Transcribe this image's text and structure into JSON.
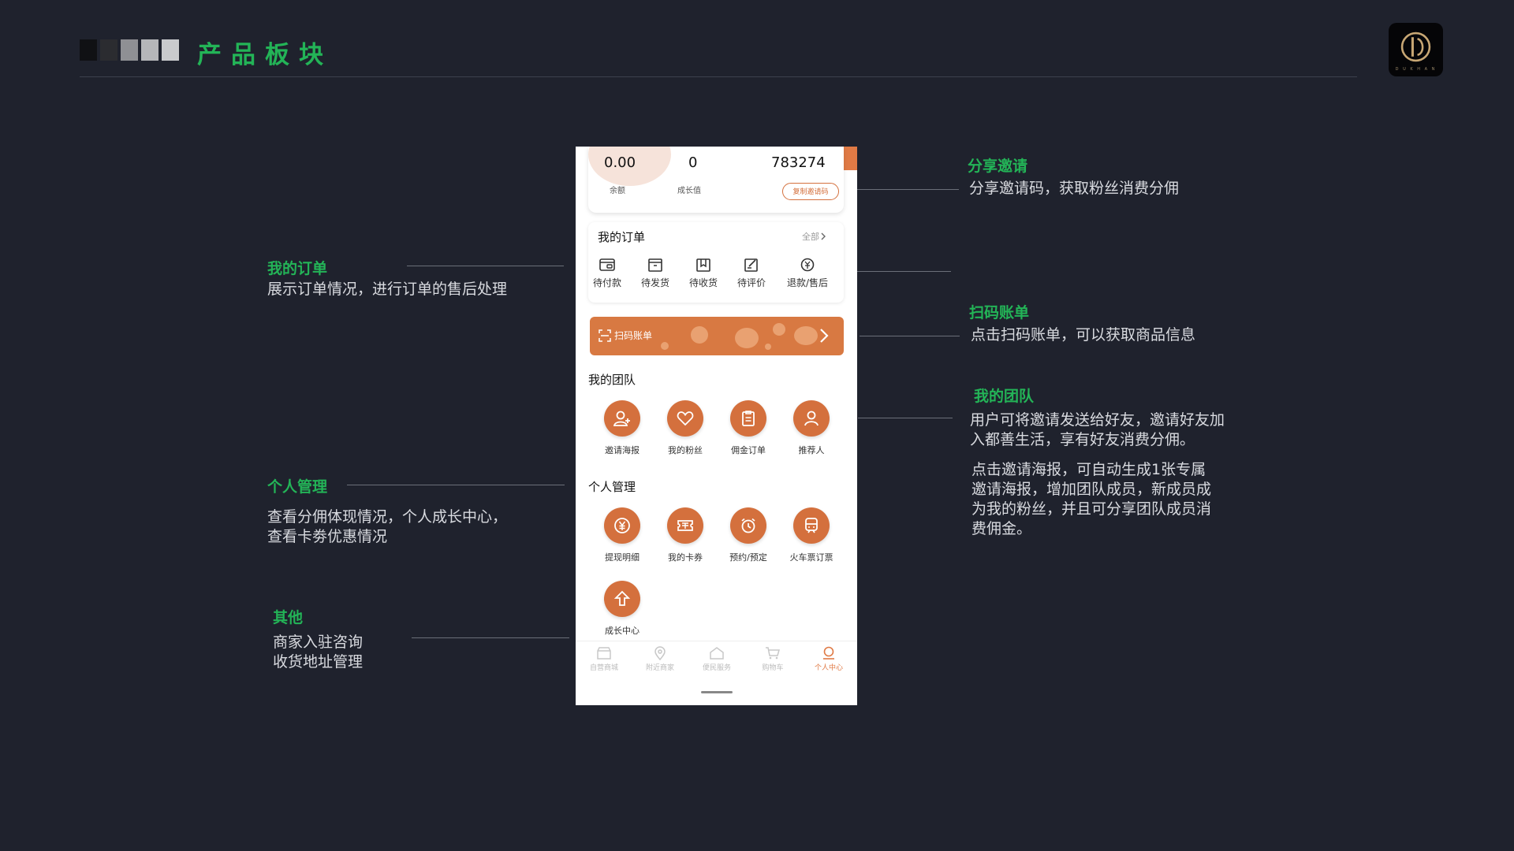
{
  "header": {
    "title": "产品板块",
    "blocks": [
      "#101114",
      "#2b2c30",
      "#8f9094",
      "#b5b6b9",
      "#c9cacd"
    ],
    "accent": "#23b457",
    "logo_text": "D U K H A N"
  },
  "annotations": {
    "orders": {
      "title": "我的订单",
      "text": "展示订单情况，进行订单的售后处理"
    },
    "personal": {
      "title": "个人管理",
      "line1": "查看分佣体现情况，个人成长中心，",
      "line2": "查看卡劵优惠情况"
    },
    "other": {
      "title": "其他",
      "line1": "商家入驻咨询",
      "line2": "收货地址管理"
    },
    "share": {
      "title": "分享邀请",
      "text": "分享邀请码，获取粉丝消费分佣"
    },
    "scan": {
      "title": "扫码账单",
      "text": "点击扫码账单，可以获取商品信息"
    },
    "team": {
      "title": "我的团队",
      "p1_line1": "用户可将邀请发送给好友，邀请好友加",
      "p1_line2": "入都善生活，享有好友消费分佣。",
      "p2_line1": "点击邀请海报，可自动生成1张专属",
      "p2_line2": "邀请海报，增加团队成员，新成员成",
      "p2_line3": "为我的粉丝，并且可分享团队成员消",
      "p2_line4": "费佣金。"
    }
  },
  "phone": {
    "stats": [
      {
        "value": "0.00",
        "label": "余额"
      },
      {
        "value": "0",
        "label": "成长值"
      },
      {
        "value": "783274",
        "label": ""
      }
    ],
    "invite_button": "复制邀请码",
    "orders": {
      "title": "我的订单",
      "all_link": "全部",
      "items": [
        {
          "label": "待付款",
          "icon": "wallet-icon"
        },
        {
          "label": "待发货",
          "icon": "box-icon"
        },
        {
          "label": "待收货",
          "icon": "package-icon"
        },
        {
          "label": "待评价",
          "icon": "edit-icon"
        },
        {
          "label": "退款/售后",
          "icon": "refund-icon"
        }
      ]
    },
    "scan_label": "扫码账单",
    "team": {
      "title": "我的团队",
      "items": [
        {
          "label": "邀请海报",
          "icon": "user-plus-icon"
        },
        {
          "label": "我的粉丝",
          "icon": "heart-icon"
        },
        {
          "label": "佣金订单",
          "icon": "clipboard-icon"
        },
        {
          "label": "推荐人",
          "icon": "user-icon"
        }
      ]
    },
    "personal": {
      "title": "个人管理",
      "items": [
        {
          "label": "提现明细",
          "icon": "yuan-icon"
        },
        {
          "label": "我的卡券",
          "icon": "ticket-icon"
        },
        {
          "label": "预约/预定",
          "icon": "alarm-icon"
        },
        {
          "label": "火车票订票",
          "icon": "train-icon"
        },
        {
          "label": "成长中心",
          "icon": "growth-icon"
        }
      ]
    },
    "tabs": [
      {
        "label": "自营商城",
        "icon": "shop-icon",
        "active": false
      },
      {
        "label": "附近商家",
        "icon": "location-icon",
        "active": false
      },
      {
        "label": "便民服务",
        "icon": "service-icon",
        "active": false
      },
      {
        "label": "购物车",
        "icon": "cart-icon",
        "active": false
      },
      {
        "label": "个人中心",
        "icon": "profile-icon",
        "active": true
      }
    ],
    "accent": "#d4703d"
  }
}
